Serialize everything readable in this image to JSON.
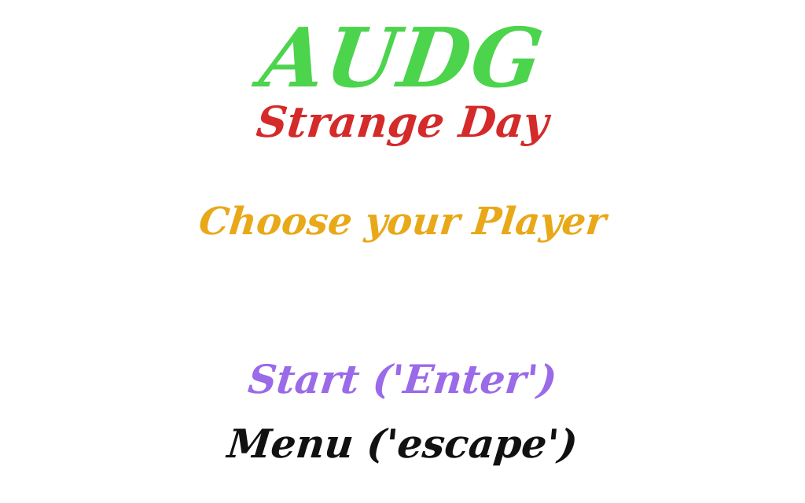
{
  "title": {
    "text": "AUDG",
    "color": "#4cd44c"
  },
  "subtitle": {
    "text": "Strange Day",
    "color": "#d42a2a"
  },
  "prompt": {
    "text": "Choose your Player",
    "color": "#e8a818"
  },
  "menu": {
    "start": {
      "label": "Start ('Enter')",
      "color": "#9a6ae8"
    },
    "escape": {
      "label": "Menu ('escape')",
      "color": "#111111"
    }
  }
}
